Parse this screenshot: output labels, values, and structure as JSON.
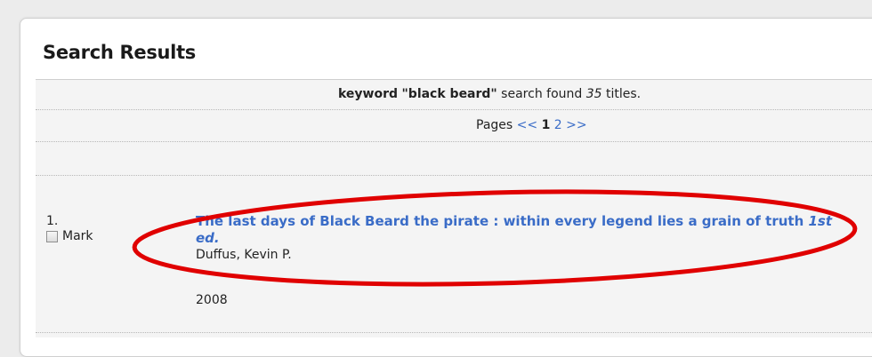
{
  "page": {
    "heading": "Search Results"
  },
  "summary": {
    "prefix": "keyword",
    "query": "\"black beard\"",
    "mid": " search found ",
    "count": "35",
    "suffix": " titles."
  },
  "pager": {
    "label": "Pages",
    "prev": "<<",
    "current": "1",
    "next_page": "2",
    "next": ">>"
  },
  "results": [
    {
      "number": "1.",
      "mark_label": "Mark",
      "title": "The last days of Black Beard the pirate : within every legend lies a grain of truth",
      "edition": "1st ed.",
      "author": "Duffus, Kevin P.",
      "year": "2008"
    }
  ],
  "annotation": {
    "color": "#e00000"
  },
  "colors": {
    "link": "#3a6cc7",
    "background": "#ececec"
  }
}
